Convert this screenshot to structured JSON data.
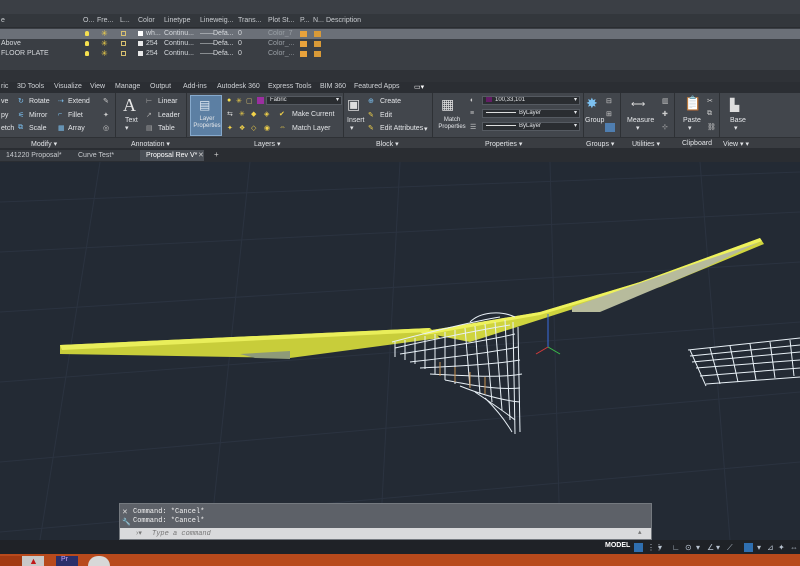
{
  "layer_manager": {
    "headers": [
      "e",
      "O...",
      "Fre...",
      "L...",
      "Color",
      "Linetype",
      "Lineweig...",
      "Trans...",
      "Plot St...",
      "P...",
      "N...",
      "Description"
    ],
    "rows": [
      {
        "name": "",
        "color": "wh...",
        "linetype": "Continu...",
        "lineweight": "Defa...",
        "trans": "0",
        "plot_style": "Color_7",
        "selected": true
      },
      {
        "name": "Above",
        "color": "254",
        "linetype": "Continu...",
        "lineweight": "Defa...",
        "trans": "0",
        "plot_style": "Color_...",
        "selected": false
      },
      {
        "name": "FLOOR PLATE",
        "color": "254",
        "linetype": "Continu...",
        "lineweight": "Defa...",
        "trans": "0",
        "plot_style": "Color_...",
        "selected": false
      }
    ]
  },
  "ribbon_tabs": [
    "ric",
    "3D Tools",
    "Visualize",
    "View",
    "Manage",
    "Output",
    "Add-ins",
    "Autodesk 360",
    "Express Tools",
    "BIM 360",
    "Featured Apps"
  ],
  "ribbon": {
    "modify": {
      "title": "Modify",
      "items": [
        "ve",
        "Rotate",
        "Extend",
        "py",
        "Mirror",
        "Fillet",
        "etch",
        "Scale",
        "Array"
      ]
    },
    "annotation": {
      "title": "Annotation",
      "text": "Text",
      "linear": "Linear",
      "leader": "Leader",
      "table": "Table"
    },
    "layers": {
      "title": "Layers",
      "layer_properties": "Layer Properties",
      "current_layer": "Fabric",
      "make_current": "Make Current",
      "match_layer": "Match Layer"
    },
    "block": {
      "title": "Block",
      "insert": "Insert",
      "create": "Create",
      "edit": "Edit",
      "edit_attributes": "Edit Attributes"
    },
    "properties": {
      "title": "Properties",
      "match_properties": "Match Properties",
      "color_value": "100,33,101",
      "linetype": "ByLayer",
      "lineweight": "ByLayer",
      "transparency": "ByLayer"
    },
    "groups": {
      "title": "Groups",
      "group": "Group"
    },
    "utilities": {
      "title": "Utilities",
      "measure": "Measure"
    },
    "clipboard": {
      "title": "Clipboard",
      "paste": "Paste"
    },
    "view": {
      "title": "View",
      "base": "Base"
    }
  },
  "doc_tabs": [
    {
      "label": "141220 Proposal*",
      "active": false
    },
    {
      "label": "Curve Test*",
      "active": false
    },
    {
      "label": "Proposal Rev V*",
      "active": true
    }
  ],
  "command": {
    "history": [
      "Command: *Cancel*",
      "Command: *Cancel*"
    ],
    "placeholder": "Type a command"
  },
  "status": {
    "model": "MODEL"
  },
  "colors": {
    "accent": "#d8dd42",
    "model_lines": "#ffffff",
    "layer_swatch": "#9b2fa0"
  }
}
